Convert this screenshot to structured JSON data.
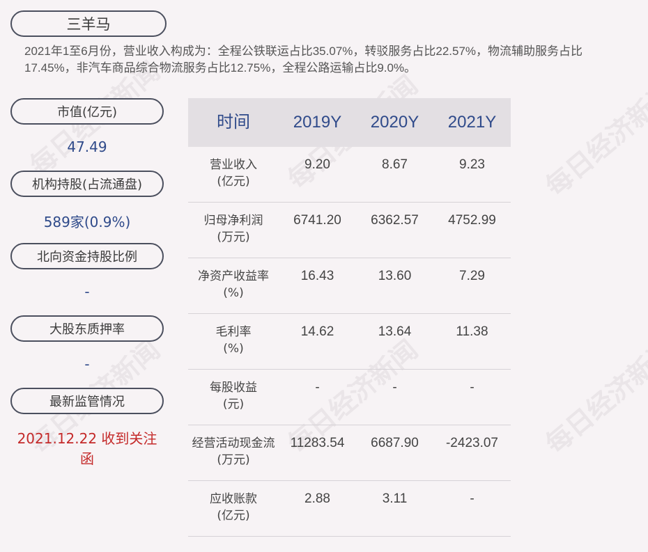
{
  "company": "三羊马",
  "summary": "2021年1至6月份，营业收入构成为：全程公铁联运占比35.07%，转驳服务占比22.57%，物流辅助服务占比17.45%，非汽车商品综合物流服务占比12.75%，全程公路运输占比9.0%。",
  "sidebar": [
    {
      "label": "市值(亿元)",
      "value": "47.49"
    },
    {
      "label": "机构持股(占流通盘)",
      "value": "589家(0.9%)"
    },
    {
      "label": "北向资金持股比例",
      "value": "-"
    },
    {
      "label": "大股东质押率",
      "value": "-"
    },
    {
      "label": "最新监管情况",
      "value": "2021.12.22 收到关注函"
    }
  ],
  "table": {
    "headers": [
      "时间",
      "2019Y",
      "2020Y",
      "2021Y"
    ],
    "rows": [
      {
        "label1": "营业收入",
        "label2": "(亿元)",
        "v": [
          "9.20",
          "8.67",
          "9.23"
        ]
      },
      {
        "label1": "归母净利润",
        "label2": "(万元)",
        "v": [
          "6741.20",
          "6362.57",
          "4752.99"
        ]
      },
      {
        "label1": "净资产收益率",
        "label2": "(%)",
        "v": [
          "16.43",
          "13.60",
          "7.29"
        ]
      },
      {
        "label1": "毛利率",
        "label2": "(%)",
        "v": [
          "14.62",
          "13.64",
          "11.38"
        ]
      },
      {
        "label1": "每股收益",
        "label2": "(元)",
        "v": [
          "-",
          "-",
          "-"
        ]
      },
      {
        "label1": "经营活动现金流",
        "label2": "(万元)",
        "v": [
          "11283.54",
          "6687.90",
          "-2423.07"
        ]
      },
      {
        "label1": "应收账款",
        "label2": "(亿元)",
        "v": [
          "2.88",
          "3.11",
          "-"
        ]
      }
    ]
  },
  "watermark": "每日经济新闻",
  "colors": {
    "accent": "#2f4a8a",
    "alert": "#c42a2a",
    "header_bg": "#e3dfe3"
  }
}
